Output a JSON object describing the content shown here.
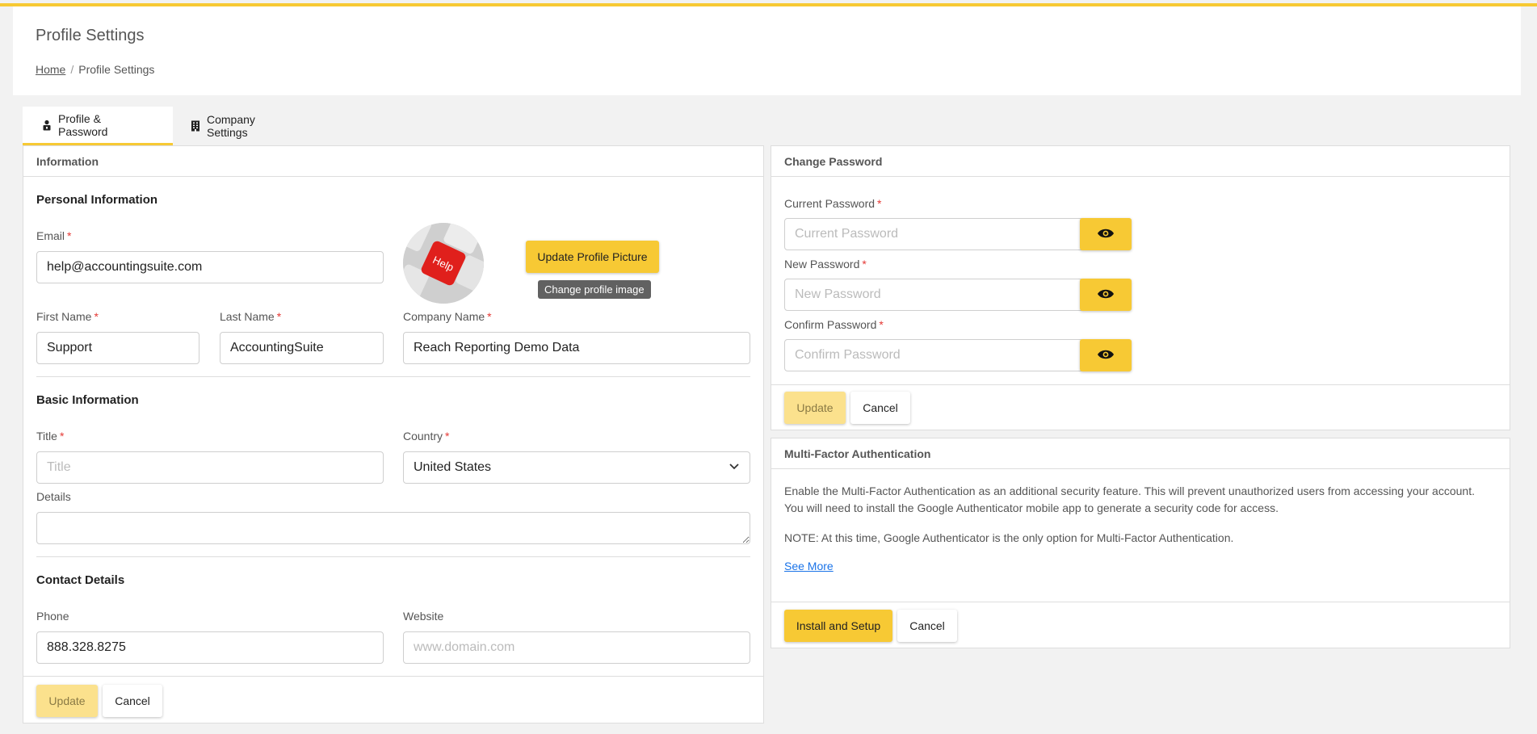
{
  "header": {
    "title": "Profile Settings",
    "breadcrumb": {
      "home": "Home",
      "separator": "/",
      "current": "Profile Settings"
    }
  },
  "tabs": [
    {
      "label": "Profile & Password",
      "icon": "user-lock-icon",
      "active": true
    },
    {
      "label": "Company Settings",
      "icon": "building-icon",
      "active": false
    }
  ],
  "information": {
    "panel_title": "Information",
    "personal": {
      "title": "Personal Information",
      "email_label": "Email",
      "email_value": "help@accountingsuite.com",
      "first_name_label": "First Name",
      "first_name_value": "Support",
      "last_name_label": "Last Name",
      "last_name_value": "AccountingSuite",
      "company_label": "Company Name",
      "company_value": "Reach Reporting Demo Data",
      "update_picture_label": "Update Profile Picture",
      "tooltip": "Change profile image",
      "avatar_key_text": "Help"
    },
    "basic": {
      "title": "Basic Information",
      "title_label": "Title",
      "title_placeholder": "Title",
      "country_label": "Country",
      "country_value": "United States",
      "details_label": "Details"
    },
    "contact": {
      "title": "Contact Details",
      "phone_label": "Phone",
      "phone_value": "888.328.8275",
      "website_label": "Website",
      "website_placeholder": "www.domain.com"
    },
    "update_label": "Update",
    "cancel_label": "Cancel"
  },
  "password": {
    "panel_title": "Change Password",
    "current_label": "Current Password",
    "current_placeholder": "Current Password",
    "new_label": "New Password",
    "new_placeholder": "New Password",
    "confirm_label": "Confirm Password",
    "confirm_placeholder": "Confirm Password",
    "update_label": "Update",
    "cancel_label": "Cancel"
  },
  "mfa": {
    "panel_title": "Multi-Factor Authentication",
    "text_line1": "Enable the Multi-Factor Authentication as an additional security feature. This will prevent unauthorized users from accessing your account.",
    "text_line2": "You will need to install the Google Authenticator mobile app to generate a security code for access.",
    "note": "NOTE: At this time, Google Authenticator is the only option for Multi-Factor Authentication.",
    "see_more": "See More",
    "install_label": "Install and Setup",
    "cancel_label": "Cancel"
  },
  "colors": {
    "accent": "#f7c934",
    "required": "#e53935",
    "link": "#1a73e8"
  }
}
